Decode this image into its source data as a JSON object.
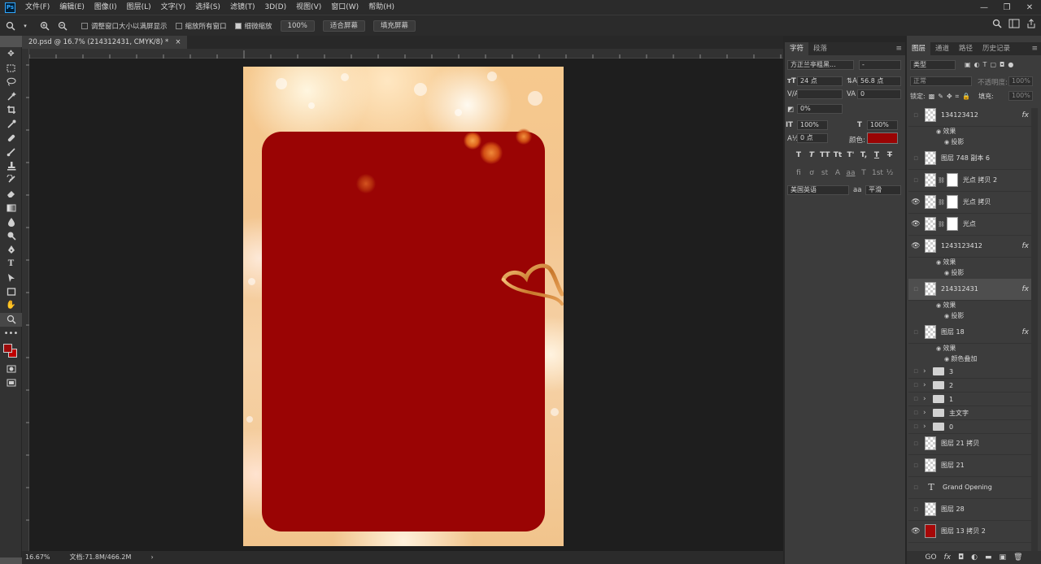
{
  "menubar": {
    "app_icon": "Ps",
    "items": [
      "文件(F)",
      "编辑(E)",
      "图像(I)",
      "图层(L)",
      "文字(Y)",
      "选择(S)",
      "滤镜(T)",
      "3D(D)",
      "视图(V)",
      "窗口(W)",
      "帮助(H)"
    ],
    "window_controls": [
      "—",
      "❐",
      "✕"
    ]
  },
  "options": {
    "check1": "调整窗口大小以满屏显示",
    "check2": "缩放所有窗口",
    "check3": "细微缩放",
    "zoom_value": "100%",
    "fit_screen": "适合屏幕",
    "fill_screen": "填充屏幕"
  },
  "document": {
    "tab_title": "20.psd @ 16.7% (214312431, CMYK/8) *",
    "close": "×"
  },
  "status": {
    "zoom": "16.67%",
    "doc_size": "文档:71.8M/466.2M",
    "arrow": "›"
  },
  "character": {
    "tabs": [
      "字符",
      "段落"
    ],
    "font_family": "方正兰亭粗黑...",
    "font_style": "-",
    "size": "24 点",
    "leading": "56.8 点",
    "kerning": "",
    "tracking": "0",
    "scale_pct": "0%",
    "vscale": "100%",
    "hscale": "100%",
    "baseline": "0 点",
    "color_label": "颜色:",
    "color": "#9a0404",
    "styles": [
      "T",
      "T",
      "TT",
      "Tt",
      "T'",
      "T,",
      "T",
      "T"
    ],
    "opentype": [
      "fi",
      "ơ",
      "st",
      "A",
      "aa",
      "T",
      "1st",
      "½"
    ],
    "language": "美国英语",
    "aa_label": "aa",
    "aa_mode": "平滑"
  },
  "layers_panel": {
    "tabs": [
      "图层",
      "通道",
      "路径",
      "历史记录"
    ],
    "filter": "类型",
    "blend": "正常",
    "opacity_label": "不透明度:",
    "opacity": "100%",
    "lock_label": "锁定:",
    "fill_label": "填充:",
    "fill": "100%",
    "rows": [
      {
        "name": "134123412",
        "visible": false,
        "fx": "fx",
        "kind": "trans"
      },
      {
        "name": "图层 748 副本 6",
        "visible": false,
        "fx": "",
        "kind": "trans"
      },
      {
        "name": "光点 拷贝 2",
        "visible": false,
        "fx": "",
        "kind": "mask"
      },
      {
        "name": "光点 拷贝",
        "visible": true,
        "fx": "",
        "kind": "mask"
      },
      {
        "name": "光点",
        "visible": true,
        "fx": "",
        "kind": "mask"
      },
      {
        "name": "1243123412",
        "visible": true,
        "fx": "fx",
        "kind": "trans"
      },
      {
        "name": "214312431",
        "visible": false,
        "fx": "fx",
        "kind": "trans",
        "selected": true
      },
      {
        "name": "图层 18",
        "visible": false,
        "fx": "fx",
        "kind": "trans"
      },
      {
        "name": "3",
        "visible": false,
        "fx": "",
        "kind": "folder"
      },
      {
        "name": "2",
        "visible": false,
        "fx": "",
        "kind": "folder"
      },
      {
        "name": "1",
        "visible": false,
        "fx": "",
        "kind": "folder"
      },
      {
        "name": "主文字",
        "visible": false,
        "fx": "",
        "kind": "folder"
      },
      {
        "name": "0",
        "visible": false,
        "fx": "",
        "kind": "folder"
      },
      {
        "name": "图层 21 拷贝",
        "visible": false,
        "fx": "",
        "kind": "trans"
      },
      {
        "name": "图层 21",
        "visible": false,
        "fx": "",
        "kind": "trans"
      },
      {
        "name": "Grand    Opening",
        "visible": false,
        "fx": "",
        "kind": "text"
      },
      {
        "name": "图层 28",
        "visible": false,
        "fx": "",
        "kind": "trans"
      },
      {
        "name": "图层 13 拷贝 2",
        "visible": true,
        "fx": "",
        "kind": "red"
      }
    ],
    "effects": {
      "effect_label": "效果",
      "shadow": "投影",
      "color_overlay": "颜色叠加"
    },
    "footer": [
      "GO",
      "fx",
      "◘",
      "◐",
      "▬",
      "▣",
      "🗑"
    ]
  },
  "icons": {
    "eye": "👁",
    "chevron": "›"
  }
}
